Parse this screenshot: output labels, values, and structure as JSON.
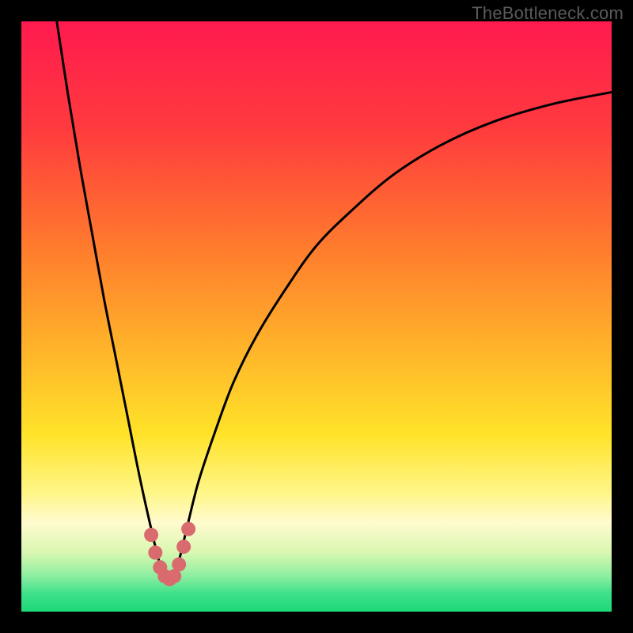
{
  "watermark": "TheBottleneck.com",
  "chart_data": {
    "type": "line",
    "title": "",
    "xlabel": "",
    "ylabel": "",
    "xlim": [
      0,
      100
    ],
    "ylim": [
      0,
      100
    ],
    "legend": false,
    "grid": false,
    "gradient_stops": [
      {
        "offset": 0.0,
        "color": "#ff1a4f"
      },
      {
        "offset": 0.18,
        "color": "#ff3a3e"
      },
      {
        "offset": 0.38,
        "color": "#ff7a2d"
      },
      {
        "offset": 0.55,
        "color": "#ffb22a"
      },
      {
        "offset": 0.7,
        "color": "#ffe329"
      },
      {
        "offset": 0.8,
        "color": "#fff68a"
      },
      {
        "offset": 0.85,
        "color": "#fffbcf"
      },
      {
        "offset": 0.9,
        "color": "#d9f7b0"
      },
      {
        "offset": 0.94,
        "color": "#8ceea0"
      },
      {
        "offset": 0.97,
        "color": "#3de08a"
      },
      {
        "offset": 1.0,
        "color": "#1cd978"
      }
    ],
    "series": [
      {
        "name": "bottleneck-curve",
        "x": [
          6,
          8,
          10,
          12,
          14,
          16,
          18,
          20,
          22,
          23.5,
          25,
          26.5,
          28,
          30,
          33,
          36,
          40,
          45,
          50,
          56,
          63,
          71,
          80,
          90,
          100
        ],
        "y": [
          100,
          87,
          75,
          64,
          53,
          43,
          33,
          23,
          14,
          8,
          5,
          8,
          14,
          22,
          31,
          39,
          47,
          55,
          62,
          68,
          74,
          79,
          83,
          86,
          88
        ]
      }
    ],
    "markers": [
      {
        "name": "marker-a",
        "x": 22.0,
        "y": 13
      },
      {
        "name": "marker-b",
        "x": 22.7,
        "y": 10
      },
      {
        "name": "marker-c",
        "x": 23.5,
        "y": 7.5
      },
      {
        "name": "marker-d",
        "x": 24.3,
        "y": 6
      },
      {
        "name": "marker-e",
        "x": 25.1,
        "y": 5.5
      },
      {
        "name": "marker-f",
        "x": 25.9,
        "y": 6
      },
      {
        "name": "marker-g",
        "x": 26.7,
        "y": 8
      },
      {
        "name": "marker-h",
        "x": 27.5,
        "y": 11
      },
      {
        "name": "marker-i",
        "x": 28.3,
        "y": 14
      }
    ]
  }
}
